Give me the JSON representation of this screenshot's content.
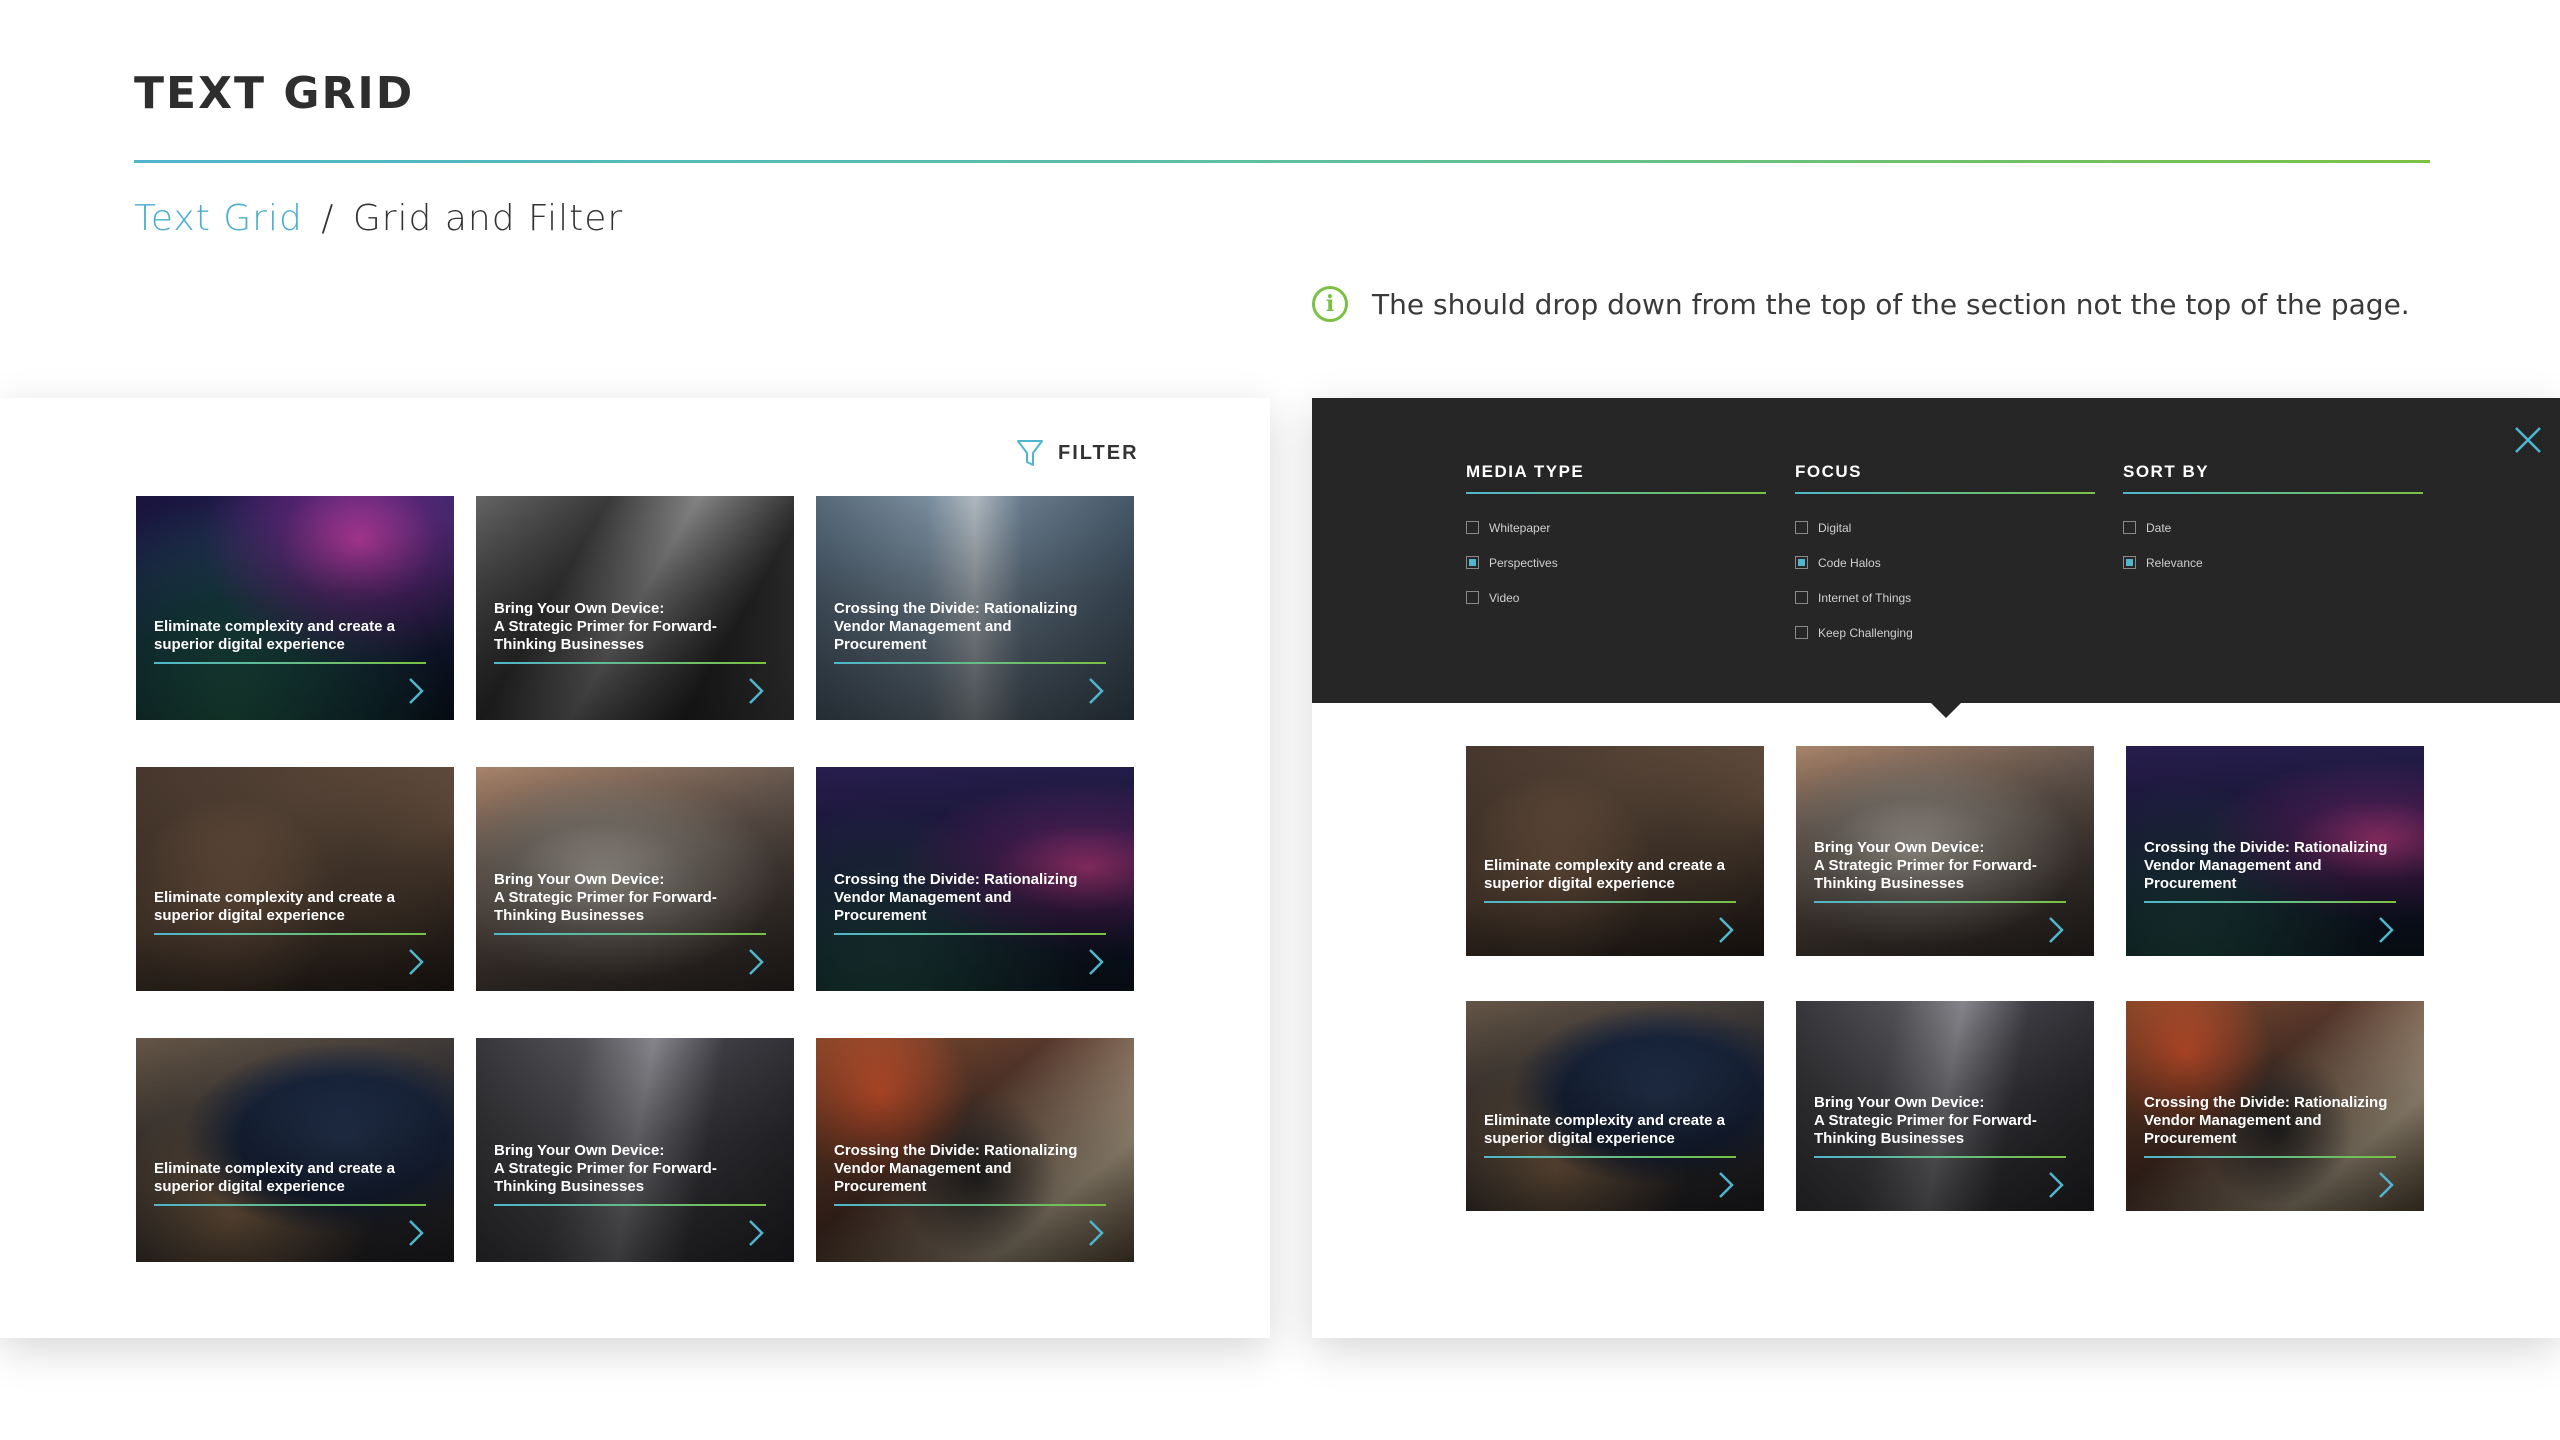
{
  "header": {
    "title": "TEXT GRID",
    "breadcrumb": {
      "link": "Text Grid",
      "separator": "/",
      "current": "Grid and Filter"
    }
  },
  "note": {
    "icon": "info-icon",
    "text": "The should drop down from the top of the section not the top of the page."
  },
  "left_panel": {
    "filter_label": "FILTER",
    "cards": [
      {
        "title": "Eliminate complexity and create a\nsuperior digital experience",
        "theme": "space"
      },
      {
        "title": "Bring Your Own Device:\nA Strategic Primer for Forward-\nThinking Businesses",
        "theme": "buildings-gray"
      },
      {
        "title": "Crossing the Divide: Rationalizing\nVendor Management and\nProcurement",
        "theme": "skyscraper"
      },
      {
        "title": "Eliminate complexity and create a\nsuperior digital experience",
        "theme": "desk"
      },
      {
        "title": "Bring Your Own Device:\nA Strategic Primer for Forward-\nThinking Businesses",
        "theme": "laptop"
      },
      {
        "title": "Crossing the Divide: Rationalizing\nVendor Management and\nProcurement",
        "theme": "space-purple"
      },
      {
        "title": "Eliminate complexity and create a\nsuperior digital experience",
        "theme": "person-blue"
      },
      {
        "title": "Bring Your Own Device:\nA Strategic Primer for Forward-\nThinking Businesses",
        "theme": "buildings-plane"
      },
      {
        "title": "Crossing the Divide: Rationalizing\nVendor Management and\nProcurement",
        "theme": "street"
      }
    ]
  },
  "right_panel": {
    "filters": [
      {
        "heading": "MEDIA TYPE",
        "options": [
          {
            "label": "Whitepaper",
            "checked": false
          },
          {
            "label": "Perspectives",
            "checked": true
          },
          {
            "label": "Video",
            "checked": false
          }
        ]
      },
      {
        "heading": "FOCUS",
        "options": [
          {
            "label": "Digital",
            "checked": false
          },
          {
            "label": "Code Halos",
            "checked": true
          },
          {
            "label": "Internet of Things",
            "checked": false
          },
          {
            "label": "Keep Challenging",
            "checked": false
          }
        ]
      },
      {
        "heading": "SORT BY",
        "options": [
          {
            "label": "Date",
            "checked": false
          },
          {
            "label": "Relevance",
            "checked": true
          }
        ]
      }
    ],
    "cards": [
      {
        "title": "Eliminate complexity and create a\nsuperior digital experience",
        "theme": "desk"
      },
      {
        "title": "Bring Your Own Device:\nA Strategic Primer for Forward-\nThinking Businesses",
        "theme": "laptop"
      },
      {
        "title": "Crossing the Divide: Rationalizing\nVendor Management and\nProcurement",
        "theme": "space-purple"
      },
      {
        "title": "Eliminate complexity and create a\nsuperior digital experience",
        "theme": "person-blue"
      },
      {
        "title": "Bring Your Own Device:\nA Strategic Primer for Forward-\nThinking Businesses",
        "theme": "buildings-plane"
      },
      {
        "title": "Crossing the Divide: Rationalizing\nVendor Management and\nProcurement",
        "theme": "street"
      }
    ]
  },
  "colors": {
    "accent_blue": "#4fb6cd",
    "accent_green": "#7ac143",
    "dark_panel": "#262626"
  }
}
